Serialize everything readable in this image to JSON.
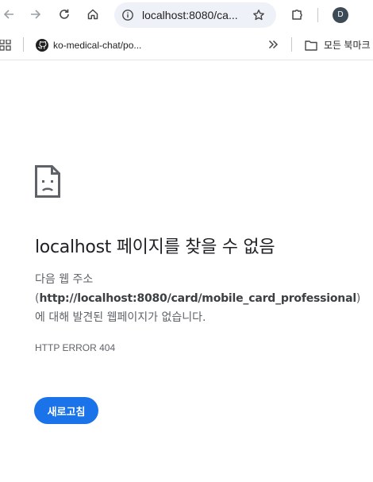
{
  "toolbar": {
    "url": "localhost:8080/ca...",
    "profile_initial": "D"
  },
  "bookmarks": {
    "items": [
      {
        "label": "ko-medical-chat/po...",
        "icon": "github-icon"
      }
    ],
    "all_bookmarks_label": "모든 북마크"
  },
  "error_page": {
    "title": "localhost 페이지를 찾을 수 없음",
    "line1": "다음 웹 주소",
    "url_open": "(",
    "url": "http://localhost:8080/card/mobile_card_professional",
    "url_close": ")",
    "line3": "에 대해 발견된 웹페이지가 없습니다.",
    "error_code": "HTTP ERROR 404",
    "reload_label": "새로고침",
    "icon": "sad-page-icon"
  },
  "colors": {
    "accent": "#1a73e8",
    "title_text": "#202124",
    "body_text": "#5f6368",
    "omnibox_bg": "#eef1f8"
  }
}
